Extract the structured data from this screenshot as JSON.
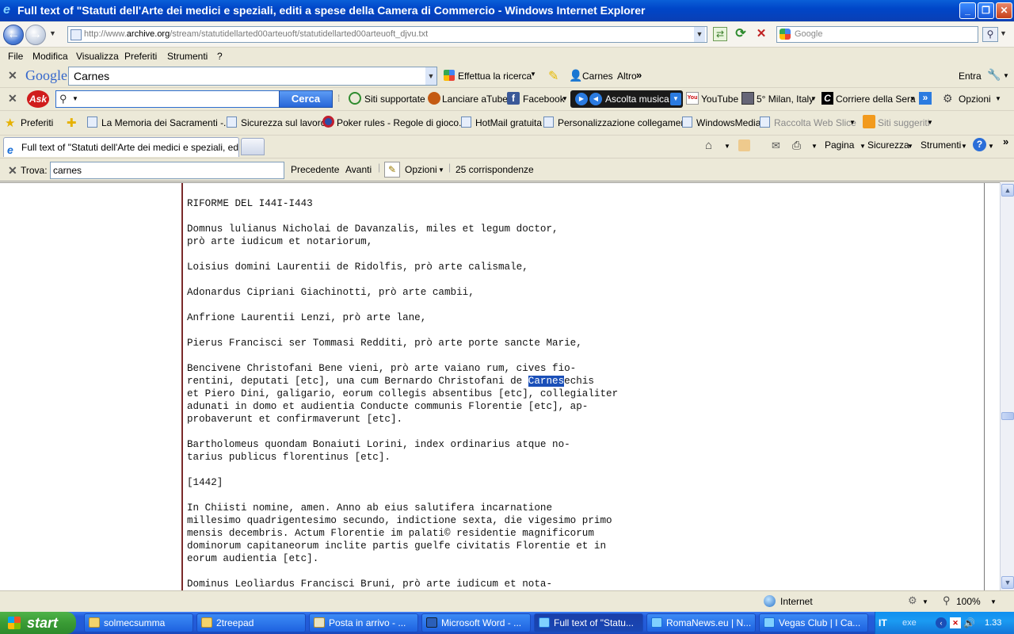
{
  "window": {
    "title": "Full text of \"Statuti dell'Arte dei medici e speziali, editi a spese della Camera di Commercio  - Windows Internet Explorer"
  },
  "address": {
    "url_prefix": "http://www.",
    "url_domain": "archive.org",
    "url_path": "/stream/statutidellarted00arteuoft/statutidellarted00arteuoft_djvu.txt",
    "search_placeholder": "Google"
  },
  "menu": [
    "File",
    "Modifica",
    "Visualizza",
    "Preferiti",
    "Strumenti",
    "?"
  ],
  "google_toolbar": {
    "logo": "Google",
    "query": "Carnes",
    "search_button": "Effettua la ricerca",
    "highlight_term": "Carnes",
    "more": "Altro",
    "signin": "Entra"
  },
  "ask_toolbar": {
    "logo": "Ask",
    "search_button": "Cerca",
    "supported_sites": "Siti supportate",
    "atube": "Lanciare aTube",
    "facebook": "Facebook",
    "music": "Ascolta musica",
    "youtube": "YouTube",
    "weather": "5° Milan, Italy",
    "corriere": "Corriere della Sera",
    "options": "Opzioni"
  },
  "favorites_bar": {
    "favorites_label": "Preferiti",
    "items": [
      "La Memoria dei Sacramenti -...",
      "Sicurezza sul lavoro",
      "Poker rules - Regole di gioco...",
      "HotMail gratuita",
      "Personalizzazione collegamenti",
      "WindowsMedia",
      "Raccolta Web Slice",
      "Siti suggeriti"
    ]
  },
  "tabs": {
    "active_title": "Full text of \"Statuti dell'Arte dei medici e speziali, editi ...",
    "page_menu": "Pagina",
    "safety_menu": "Sicurezza",
    "tools_menu": "Strumenti"
  },
  "find_bar": {
    "label": "Trova:",
    "query": "carnes",
    "prev": "Precedente",
    "next": "Avanti",
    "options": "Opzioni",
    "matches": "25 corrispondenze"
  },
  "document": {
    "before_highlight": "RIFORME DEL I44I-I443\n\nDomnus lulianus Nicholai de Davanzalis, miles et legum doctor,\nprò arte iudicum et notariorum,\n\nLoisius domini Laurentii de Ridolfis, prò arte calismale,\n\nAdonardus Cipriani Giachinotti, prò arte cambii,\n\nAnfrione Laurentii Lenzi, prò arte lane,\n\nPierus Francisci ser Tommasi Redditi, prò arte porte sancte Marie,\n\nBencivene Christofani Bene vieni, prò arte vaiano rum, cives fio-\nrentini, deputati [etc], una cum Bernardo Christofani de ",
    "highlight": "Carnes",
    "after_highlight": "echis\net Piero Dini, galigario, eorum collegis absentibus [etc], collegialiter\nadunati in domo et audientia Conducte communis Florentie [etc], ap-\nprobaverunt et confirmaverunt [etc].\n\nBartholomeus quondam Bonaiuti Lorini, index ordinarius atque no-\ntarius publicus florentinus [etc].\n\n[1442]\n\nIn Chiisti nomine, amen. Anno ab eius salutifera incarnatione\nmillesimo quadrigentesimo secundo, indictione sexta, die vigesimo primo\nmensis decembris. Actum Florentie im palati© residentie magnificorum\ndominorum capitaneorum inclite partis guelfe civitatis Florentie et in\neorum audientia [etc].\n\nDominus Leolìardus Francisci Bruni, prò arte iudicum et nota-"
  },
  "status": {
    "zone": "Internet",
    "zoom": "100%"
  },
  "taskbar": {
    "start": "start",
    "tasks": [
      "solmecsumma",
      "2treepad",
      "Posta in arrivo - ...",
      "Microsoft Word - ...",
      "Full text of \"Statu...",
      "RomaNews.eu | N...",
      "Vegas Club | I Ca..."
    ],
    "lang": "IT",
    "tray_text": "exe",
    "clock": "1.33"
  }
}
